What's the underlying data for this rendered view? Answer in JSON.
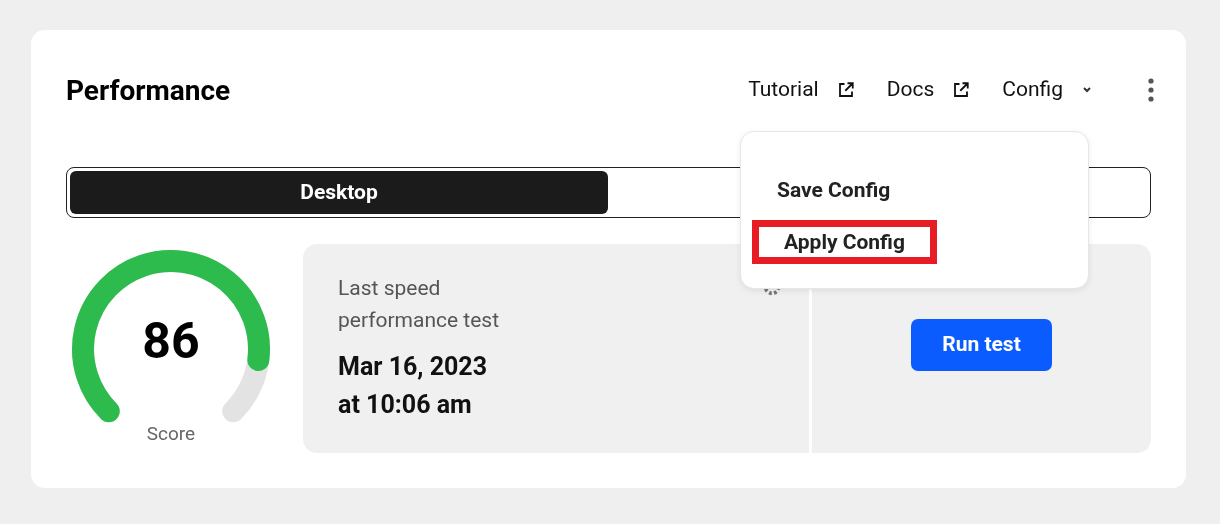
{
  "card": {
    "title": "Performance"
  },
  "header_links": [
    {
      "kind": "external",
      "label": "Tutorial"
    },
    {
      "kind": "external",
      "label": "Docs"
    },
    {
      "kind": "dropdown",
      "label": "Config",
      "expanded": true
    }
  ],
  "config_menu": [
    {
      "label": "Save Config",
      "highlighted": false
    },
    {
      "label": "Apply Config",
      "highlighted": true
    }
  ],
  "tabs": [
    {
      "label": "Desktop",
      "selected": true
    }
  ],
  "gauge": {
    "value": "86",
    "caption": "Score"
  },
  "last_test": {
    "label": "Last speed performance test",
    "date": "Mar 16, 2023",
    "time": "at 10:06 am"
  },
  "run_button": "Run test"
}
